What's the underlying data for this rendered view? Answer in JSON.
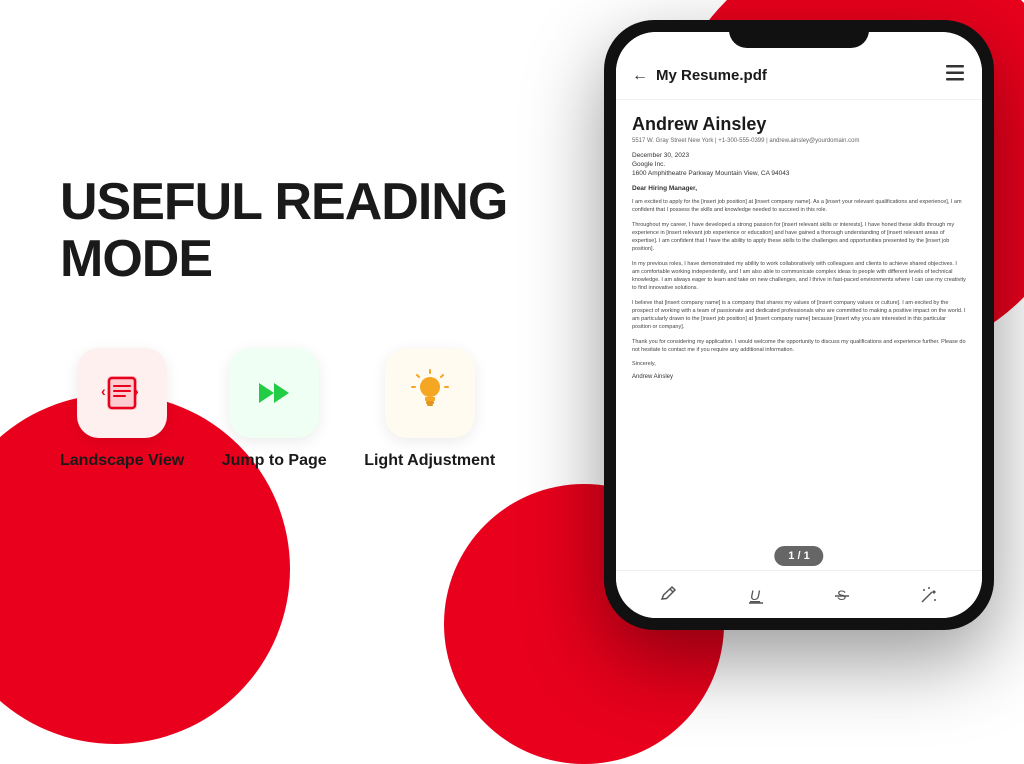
{
  "background": {
    "primary_color": "#e8001c",
    "secondary_color": "#ffffff"
  },
  "left_panel": {
    "title": "USEFUL READING MODE",
    "features": [
      {
        "id": "landscape",
        "label": "Landscape View",
        "icon_name": "landscape-icon",
        "icon_symbol": "⊟",
        "icon_color": "#e8001c",
        "bg_class": "red-bg"
      },
      {
        "id": "jump",
        "label": "Jump to Page",
        "icon_name": "jump-icon",
        "icon_symbol": "⏩",
        "icon_color": "#22cc44",
        "bg_class": "green-bg"
      },
      {
        "id": "light",
        "label": "Light Adjustment",
        "icon_name": "light-icon",
        "icon_symbol": "💡",
        "icon_color": "#f5a623",
        "bg_class": "yellow-bg"
      }
    ]
  },
  "phone": {
    "header": {
      "back_label": "←",
      "title": "My Resume.pdf",
      "menu_icon": "⋮"
    },
    "resume": {
      "name": "Andrew Ainsley",
      "contact": "5517 W. Gray Street  New York | +1-300-555-0399 | andrew.ainsley@yourdomain.com",
      "date": "December 30, 2023",
      "company_name": "Google Inc.",
      "company_address": "1600 Amphitheatre Parkway Mountain View, CA 94043",
      "greeting": "Dear Hiring Manager,",
      "paragraphs": [
        "I am excited to apply for the [insert job position] at [insert company name]. As a [insert your relevant qualifications and experience], I am confident that I possess the skills and knowledge needed to succeed in this role.",
        "Throughout my career, I have developed a strong passion for [insert relevant skills or interests]. I have honed these skills through my experience in [insert relevant job experience or education] and have gained a thorough understanding of [insert relevant areas of expertise]. I am confident that I have the ability to apply these skills to the challenges and opportunities presented by the [insert job position].",
        "In my previous roles, I have demonstrated my ability to work collaboratively with colleagues and clients to achieve shared objectives. I am comfortable working independently, and I am also able to communicate complex ideas to people with different levels of technical knowledge. I am always eager to learn and take on new challenges, and I thrive in fast-paced environments where I can use my creativity to find innovative solutions.",
        "I believe that [insert company name] is a company that shares my values of [insert company values or culture]. I am excited by the prospect of working with a team of passionate and dedicated professionals who are committed to making a positive impact on the world. I am particularly drawn to the [insert job position] at [insert company name] because [insert why you are interested in this particular position or company].",
        "Thank you for considering my application. I would welcome the opportunity to discuss my qualifications and experience further. Please do not hesitate to contact me if you require any additional information.",
        "Sincerely,"
      ],
      "signature": "Andrew Ainsley",
      "page_indicator": "1 / 1"
    },
    "toolbar_icons": [
      {
        "name": "pen-icon",
        "symbol": "✏"
      },
      {
        "name": "underline-icon",
        "symbol": "U"
      },
      {
        "name": "strikethrough-icon",
        "symbol": "S"
      },
      {
        "name": "magic-icon",
        "symbol": "✨"
      }
    ]
  }
}
